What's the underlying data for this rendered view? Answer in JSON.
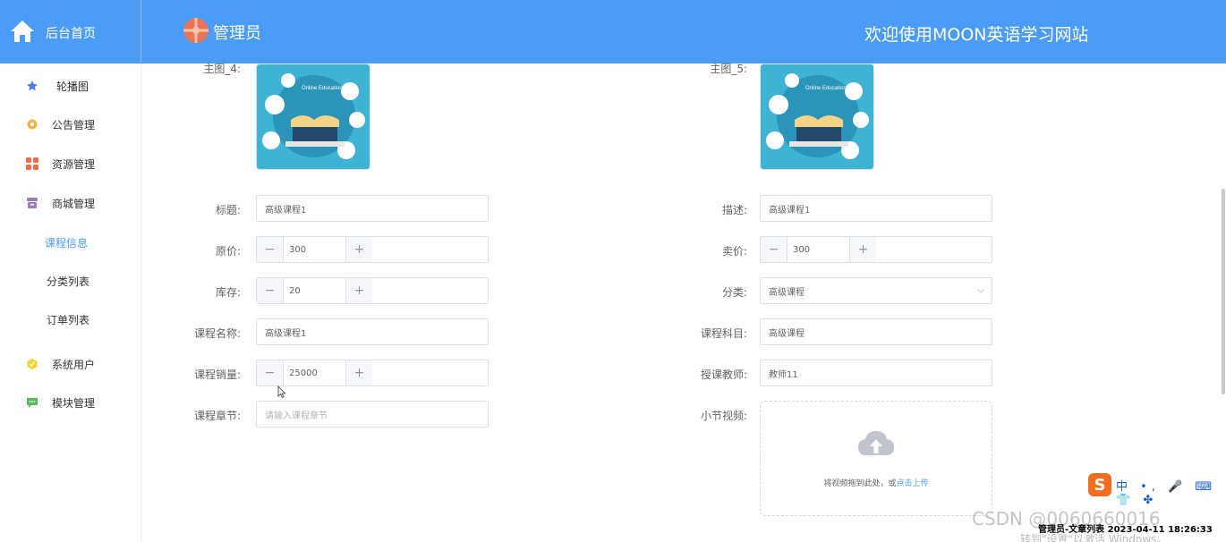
{
  "header": {
    "home_label": "后台首页",
    "admin_name": "管理员",
    "welcome": "欢迎使用MOON英语学习网站",
    "bg_color": "#4a9cf7"
  },
  "sidebar": {
    "items": [
      {
        "label": "轮播图",
        "icon": "star-icon",
        "color": "#4a7cf0"
      },
      {
        "label": "公告管理",
        "icon": "gear-icon",
        "color": "#f0b24b"
      },
      {
        "label": "资源管理",
        "icon": "grid-icon",
        "color": "#f06a4b"
      },
      {
        "label": "商城管理",
        "icon": "archive-icon",
        "color": "#9b7bc0"
      }
    ],
    "sub_items": [
      {
        "label": "课程信息",
        "active": true
      },
      {
        "label": "分类列表",
        "active": false
      },
      {
        "label": "订单列表",
        "active": false
      }
    ],
    "bottom_items": [
      {
        "label": "系统用户",
        "icon": "user-icon",
        "color": "#f5d42b"
      },
      {
        "label": "模块管理",
        "icon": "chat-icon",
        "color": "#5cb85c"
      }
    ]
  },
  "form": {
    "image4_label": "主图_4:",
    "image5_label": "主图_5:",
    "image_caption": "Online Education",
    "title_label": "标题:",
    "title_value": "高级课程1",
    "desc_label": "描述:",
    "desc_value": "高级课程1",
    "orig_price_label": "原价:",
    "orig_price_value": "300",
    "sale_price_label": "卖价:",
    "sale_price_value": "300",
    "stock_label": "库存:",
    "stock_value": "20",
    "category_label": "分类:",
    "category_value": "高级课程",
    "course_name_label": "课程名称:",
    "course_name_value": "高级课程1",
    "course_subject_label": "课程科目:",
    "course_subject_value": "高级课程",
    "sales_label": "课程销量:",
    "sales_value": "25000",
    "teacher_label": "授课教师:",
    "teacher_value": "教师11",
    "chapter_label": "课程章节:",
    "chapter_placeholder": "请输入课程章节",
    "video_label": "小节视频:",
    "upload_text": "将视频拖到此处，或",
    "upload_link": "点击上传",
    "minus": "−",
    "plus": "+"
  },
  "overlay": {
    "ime_logo": "S",
    "ime_text": "中 •, 🎤 ⌨ 👕 ✤",
    "tray_text": "管理员-文章列表 2023-04-11 18:26:33",
    "watermark": "CSDN @0060660016",
    "activate": "转到\"设置\"以激活 Windows。"
  }
}
